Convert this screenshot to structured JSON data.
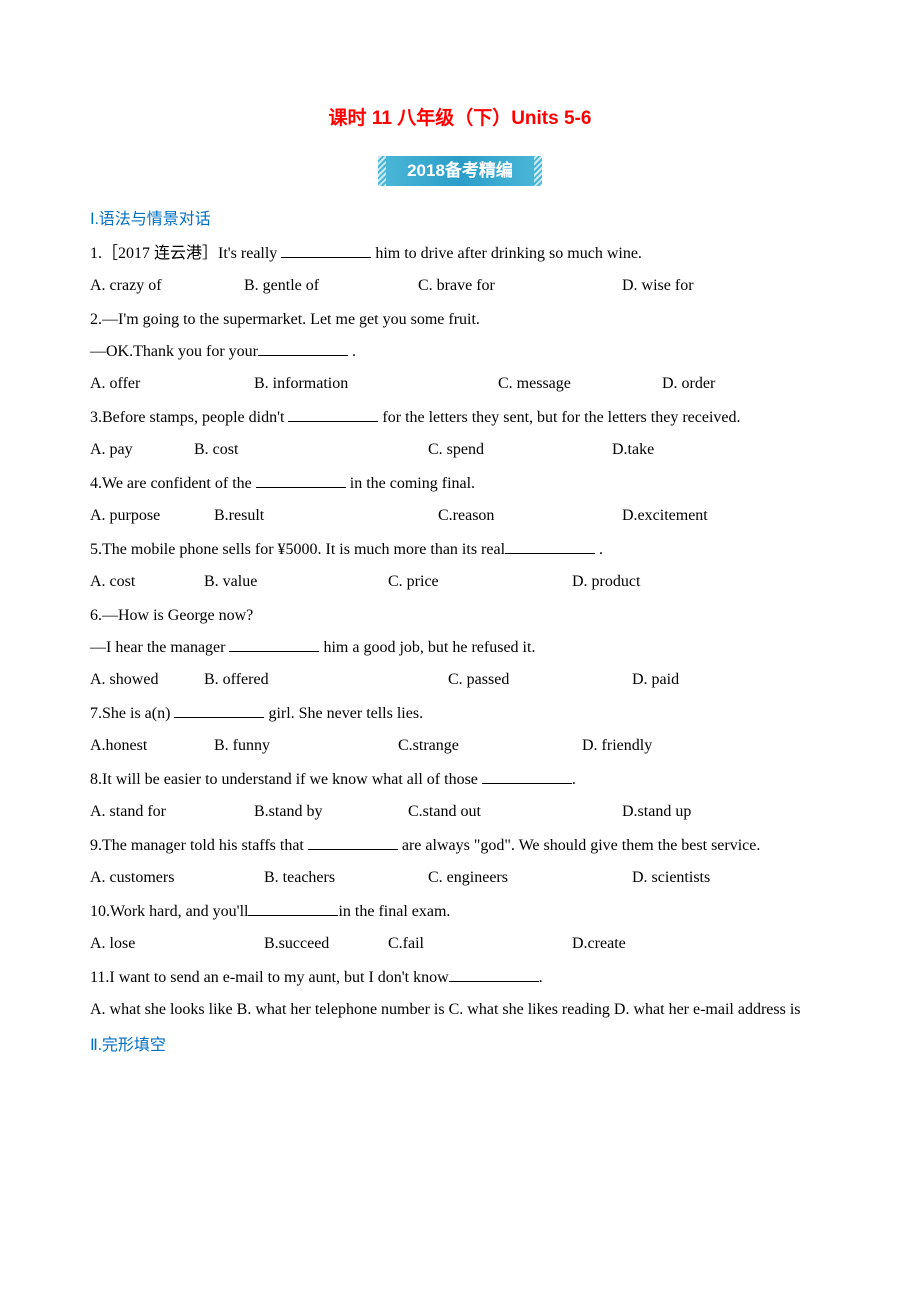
{
  "title": "课时 11 八年级（下）Units 5-6",
  "banner": "2018备考精编",
  "sections": {
    "s1": {
      "header": "Ⅰ.语法与情景对话",
      "q1": {
        "text_before": "1.［2017 连云港］It's really ",
        "text_after": " him to drive after drinking so much wine.",
        "a": "A. crazy of",
        "b": "B. gentle of",
        "c": "C. brave for",
        "d": "D. wise for"
      },
      "q2": {
        "line1": "2.—I'm going to the supermarket. Let me get you some fruit.",
        "line2_before": "—OK.Thank you for your",
        "line2_after": " .",
        "a": "A. offer",
        "b": "B. information",
        "c": "C. message",
        "d": "D. order"
      },
      "q3": {
        "text_before": "3.Before stamps, people didn't ",
        "text_after": " for the letters they sent, but for the letters they received.",
        "a": "A. pay",
        "b": "B. cost",
        "c": "C. spend",
        "d": "D.take"
      },
      "q4": {
        "text_before": "4.We are confident of the ",
        "text_after": " in the coming final.",
        "a": "A. purpose",
        "b": "B.result",
        "c": "C.reason",
        "d": "D.excitement"
      },
      "q5": {
        "text_before": "5.The mobile phone sells for ¥5000. It is much more than its real",
        "text_after": " .",
        "a": "A. cost",
        "b": "B. value",
        "c": "C. price",
        "d": "D. product"
      },
      "q6": {
        "line1": "6.—How is George now?",
        "line2_before": "—I hear the manager ",
        "line2_after": " him a good job, but he refused it.",
        "a": "A. showed",
        "b": "B. offered",
        "c": "C. passed",
        "d": "D. paid"
      },
      "q7": {
        "text_before": "7.She is a(n) ",
        "text_after": " girl. She never tells lies.",
        "a": "A.honest",
        "b": "B. funny",
        "c": "C.strange",
        "d": "D. friendly"
      },
      "q8": {
        "text_before": "8.It will be easier to understand if we know what all of those ",
        "text_after": ".",
        "a": "A. stand for",
        "b": "B.stand by",
        "c": "C.stand out",
        "d": "D.stand up"
      },
      "q9": {
        "text_before": "9.The manager told his staffs that ",
        "text_after": " are always \"god\". We should give them the best service.",
        "a": "A. customers",
        "b": "B. teachers",
        "c": "C. engineers",
        "d": "D. scientists"
      },
      "q10": {
        "text_before": "10.Work hard, and you'll",
        "text_after": "in the final exam.",
        "a": "A. lose",
        "b": "B.succeed",
        "c": "C.fail",
        "d": "D.create"
      },
      "q11": {
        "text_before": "11.I want to send an e-mail to my aunt, but I don't know",
        "text_after": ".",
        "a": "A. what she looks like",
        "b": "B. what her telephone number is",
        "c": "C. what she likes reading",
        "d": "D. what her e-mail address is"
      }
    },
    "s2": {
      "header": "Ⅱ.完形填空"
    }
  }
}
